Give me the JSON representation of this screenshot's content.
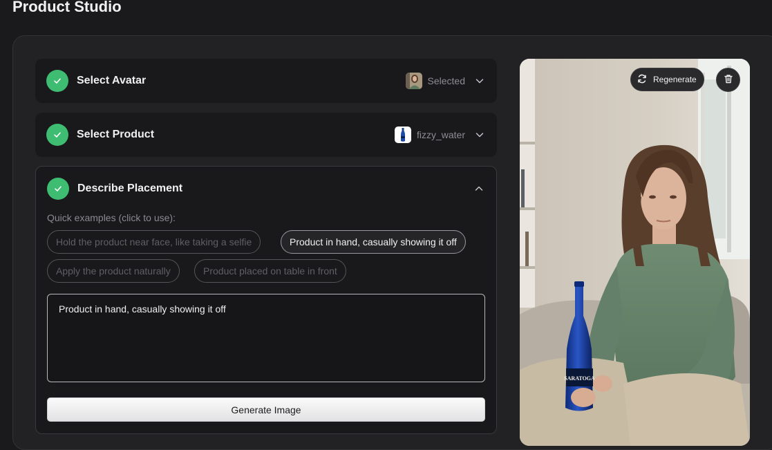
{
  "page": {
    "title": "Product Studio"
  },
  "steps": {
    "avatar": {
      "title": "Select Avatar",
      "status": "Selected"
    },
    "product": {
      "title": "Select Product",
      "status": "fizzy_water"
    },
    "placement": {
      "title": "Describe Placement",
      "examples_label": "Quick examples (click to use):",
      "examples": [
        "Hold the product near face, like taking a selfie",
        "Product in hand, casually showing it off",
        "Apply the product naturally",
        "Product placed on table in front"
      ],
      "selected_example_index": 1,
      "prompt_value": "Product in hand, casually showing it off",
      "generate_label": "Generate Image"
    }
  },
  "preview": {
    "regenerate_label": "Regenerate",
    "bottle_label": "SARATOGA"
  },
  "colors": {
    "accent_green": "#3ebd72",
    "background": "#1a1a1c",
    "panel": "#222224"
  },
  "icons": [
    "check-icon",
    "chevron-down-icon",
    "chevron-up-icon",
    "refresh-icon",
    "trash-icon"
  ]
}
